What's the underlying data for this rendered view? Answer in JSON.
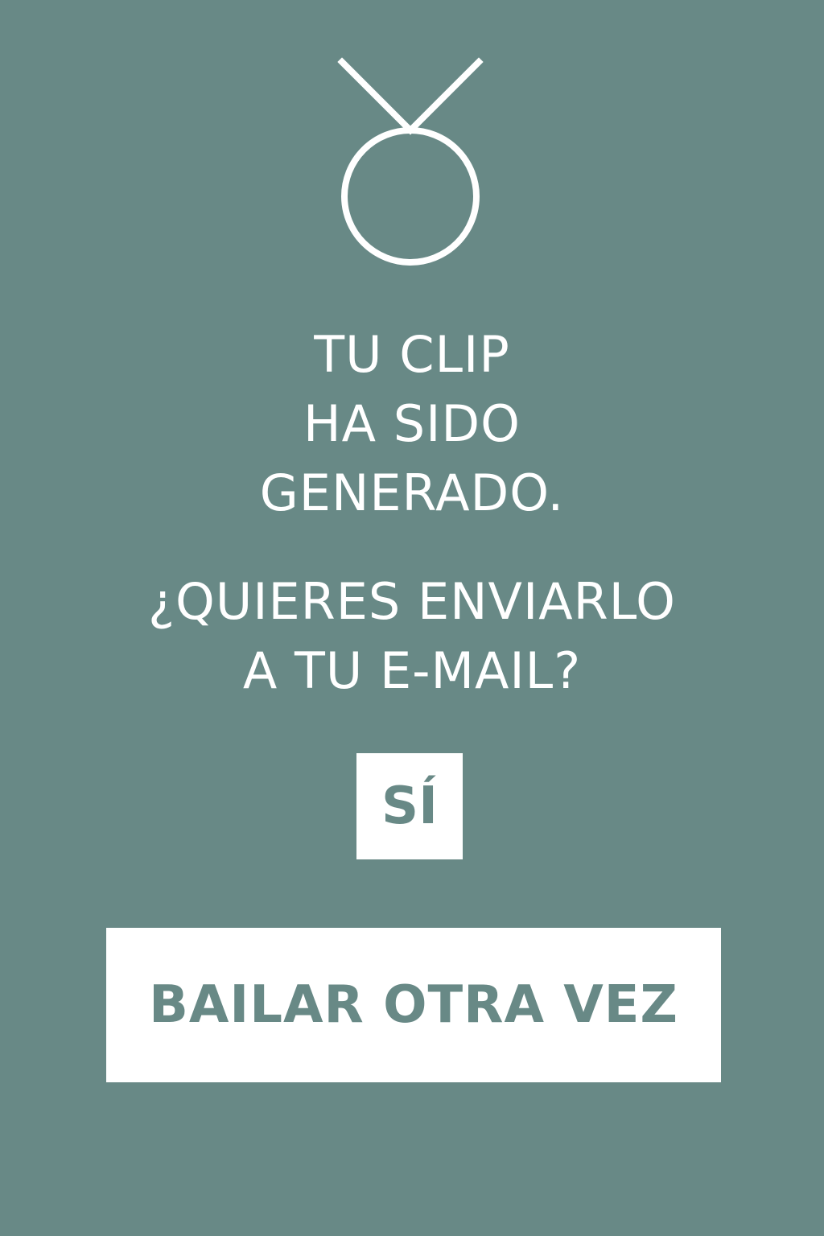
{
  "logo": {
    "icon": "taurus-symbol-icon"
  },
  "message": {
    "line1": "TU CLIP",
    "line2": "HA SIDO",
    "line3": "GENERADO.",
    "question_line1": "¿QUIERES ENVIARLO",
    "question_line2": "A TU E-MAIL?"
  },
  "actions": {
    "yes_label": "SÍ",
    "again_label": "BAILAR OTRA VEZ"
  },
  "colors": {
    "background": "#688986",
    "foreground": "#ffffff"
  }
}
